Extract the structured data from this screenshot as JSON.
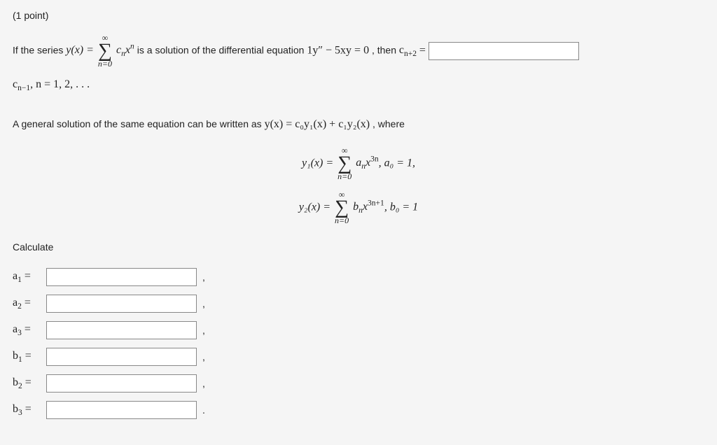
{
  "points_label": "(1 point)",
  "intro": {
    "prefix": "If the series ",
    "series_eq": "y(x) = ",
    "sigma_top": "∞",
    "sigma_bottom": "n=0",
    "series_term": "c",
    "series_sub": "n",
    "series_xpow": "x",
    "series_pow": "n",
    "mid": " is a solution of the differential equation ",
    "diffeq_lhs": "1y″ − 5xy = 0",
    "then": ", then ",
    "recur_lhs": "c",
    "recur_sub": "n+2",
    "equals": " = "
  },
  "cn_tail": {
    "c": "c",
    "sub": "n−1",
    "rest": ", n = 1, 2, . . ."
  },
  "general_text": "A general solution of the same equation can be written as ",
  "general_eq": "y(x) = c₀y₁(x) + c₁y₂(x)",
  "where": ", where",
  "y1": {
    "lhs": "y₁(x) = ",
    "sigma_top": "∞",
    "sigma_bottom": "n=0",
    "coef": "a",
    "coef_sub": "n",
    "x": "x",
    "pow": "3n",
    "tail": ", a₀ = 1,"
  },
  "y2": {
    "lhs": "y₂(x) = ",
    "sigma_top": "∞",
    "sigma_bottom": "n=0",
    "coef": "b",
    "coef_sub": "n",
    "x": "x",
    "pow": "3n+1",
    "tail": ", b₀ = 1"
  },
  "calculate": "Calculate",
  "rows": [
    {
      "label_base": "a",
      "label_sub": "1",
      "punct": ","
    },
    {
      "label_base": "a",
      "label_sub": "2",
      "punct": ","
    },
    {
      "label_base": "a",
      "label_sub": "3",
      "punct": ","
    },
    {
      "label_base": "b",
      "label_sub": "1",
      "punct": ","
    },
    {
      "label_base": "b",
      "label_sub": "2",
      "punct": ","
    },
    {
      "label_base": "b",
      "label_sub": "3",
      "punct": "."
    }
  ]
}
